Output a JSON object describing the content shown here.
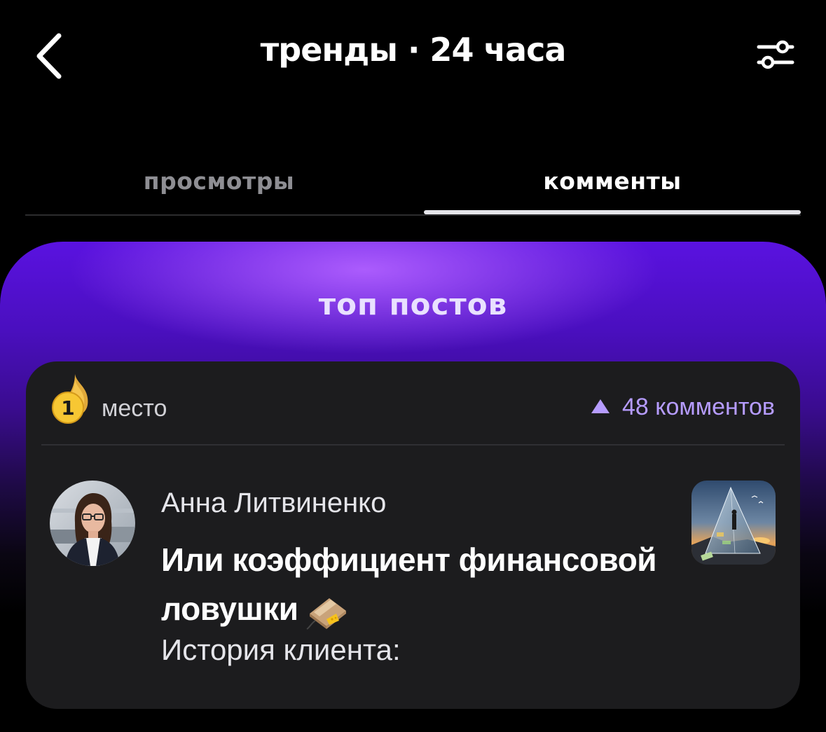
{
  "header": {
    "title": "тренды · 24 часа",
    "back_icon": "chevron-left-icon",
    "filter_icon": "sliders-icon"
  },
  "tabs": [
    {
      "label": "просмотры",
      "active": false
    },
    {
      "label": "комменты",
      "active": true
    }
  ],
  "panel": {
    "title": "топ постов",
    "gradient_colors": [
      "#5a12e0",
      "#b060ff",
      "#000000"
    ]
  },
  "post": {
    "rank": "1",
    "rank_label": "место",
    "comments_count": "48 комментов",
    "author": "Анна Литвиненко",
    "title": "Или коэффициент финансовой ловушки",
    "excerpt": "История клиента:",
    "trap_icon": "mousetrap-icon",
    "accent_color": "#b69cff"
  }
}
